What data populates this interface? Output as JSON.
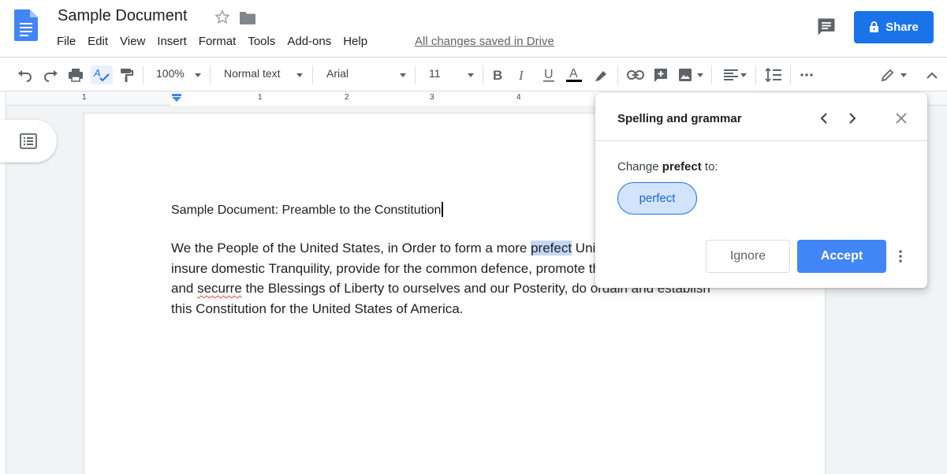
{
  "header": {
    "title": "Sample Document",
    "menu": [
      "File",
      "Edit",
      "View",
      "Insert",
      "Format",
      "Tools",
      "Add-ons",
      "Help"
    ],
    "saved_status": "All changes saved in Drive",
    "share_label": "Share"
  },
  "toolbar": {
    "zoom": "100%",
    "style": "Normal text",
    "font": "Arial",
    "font_size": "11"
  },
  "ruler": {
    "numbers": [
      "1",
      "1",
      "2",
      "3",
      "4"
    ]
  },
  "document": {
    "heading": "Sample Document: Preamble to the Constitution",
    "para_pre": "We the People of the United States, in Order to form a more ",
    "para_highlight": "prefect",
    "para_mid1": " Union, establish Justice, insure domestic Tranquility, provide for the common defence, promote the general Welfare, and ",
    "para_misspelled": "securre",
    "para_post": " the Blessings of Liberty to ourselves and our Posterity, do ordain and establish this Constitution for the United States of America."
  },
  "spelling_dialog": {
    "title": "Spelling and grammar",
    "change_prefix": "Change",
    "change_word": "prefect",
    "change_suffix": "to:",
    "suggestion": "perfect",
    "ignore_label": "Ignore",
    "accept_label": "Accept"
  },
  "colors": {
    "accent": "#1a73e8",
    "accept_bg": "#4285f4",
    "highlight": "#c6d7f6",
    "misspell": "#ea4335"
  }
}
